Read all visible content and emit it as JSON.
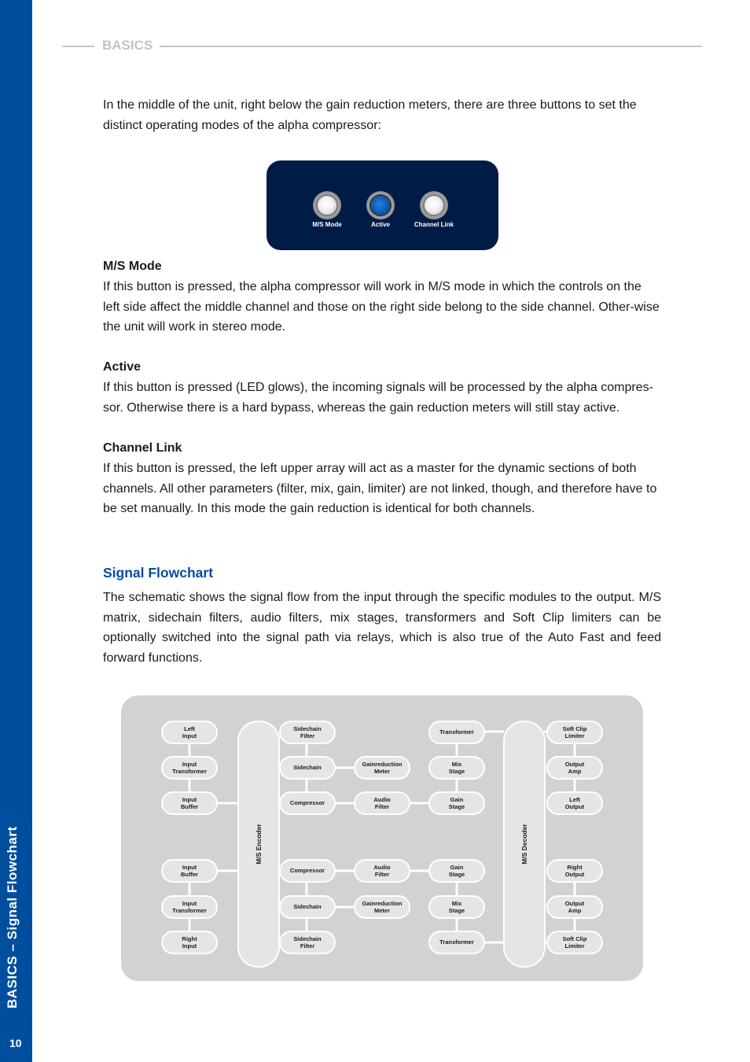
{
  "sidebar": {
    "title": "BASICS – Signal Flowchart",
    "page_number": "10",
    "color": "#004f9f"
  },
  "header": {
    "section": "BASICS"
  },
  "intro": "In the middle of the unit, right below the gain reduction meters, there are three buttons to set the distinct operating modes of the alpha compressor:",
  "panel": {
    "buttons": [
      {
        "label": "M/S Mode",
        "state": "off"
      },
      {
        "label": "Active",
        "state": "on"
      },
      {
        "label": "Channel Link",
        "state": "off"
      }
    ]
  },
  "modes": [
    {
      "title": "M/S Mode",
      "text": "If this button is pressed, the alpha compressor will work in M/S mode in which the controls on the left side affect the middle channel and those on the right side belong to the side channel. Other-wise the unit will work in stereo mode."
    },
    {
      "title": "Active",
      "text": "If this button is pressed (LED glows), the incoming signals will be processed by the alpha compres-sor. Otherwise there is a hard bypass, whereas the gain reduction meters will still stay active."
    },
    {
      "title": "Channel Link",
      "text": "If this button is pressed, the left upper array will act as a master for the dynamic sections of both channels. All other parameters (filter, mix, gain, limiter) are not linked, though, and therefore have to be set manually. In this mode the gain reduction is identical for both channels."
    }
  ],
  "signal_flowchart": {
    "title": "Signal Flowchart",
    "description": "The schematic shows the signal flow from the input through the specific modules to the output. M/S matrix, sidechain filters, audio filters, mix stages, transformers and Soft Clip limiters can be optionally switched into the signal path via relays, which is also true of the Auto Fast and feed forward functions.",
    "encoder_label": "M/S Encoder",
    "decoder_label": "M/S Decoder",
    "left_channel": {
      "input_chain": [
        "Left\nInput",
        "Input\nTransformer",
        "Input\nBuffer"
      ],
      "sidechain_chain": [
        "Sidechain\nFilter",
        "Sidechain",
        "Compressor"
      ],
      "meter_filter": [
        "Gainreduction\nMeter",
        "Audio\nFilter"
      ],
      "stage_chain": [
        "Transformer",
        "Mix\nStage",
        "Gain\nStage"
      ],
      "output_chain": [
        "Soft Clip\nLimiter",
        "Output\nAmp",
        "Left\nOutput"
      ]
    },
    "right_channel": {
      "input_chain": [
        "Input\nBuffer",
        "Input\nTransformer",
        "Right\nInput"
      ],
      "sidechain_chain": [
        "Compressor",
        "Sidechain",
        "Sidechain\nFilter"
      ],
      "meter_filter": [
        "Audio\nFilter",
        "Gainreduction\nMeter"
      ],
      "stage_chain": [
        "Gain\nStage",
        "Mix\nStage",
        "Transformer"
      ],
      "output_chain": [
        "Right\nOutput",
        "Output\nAmp",
        "Soft Clip\nLimiter"
      ]
    }
  }
}
